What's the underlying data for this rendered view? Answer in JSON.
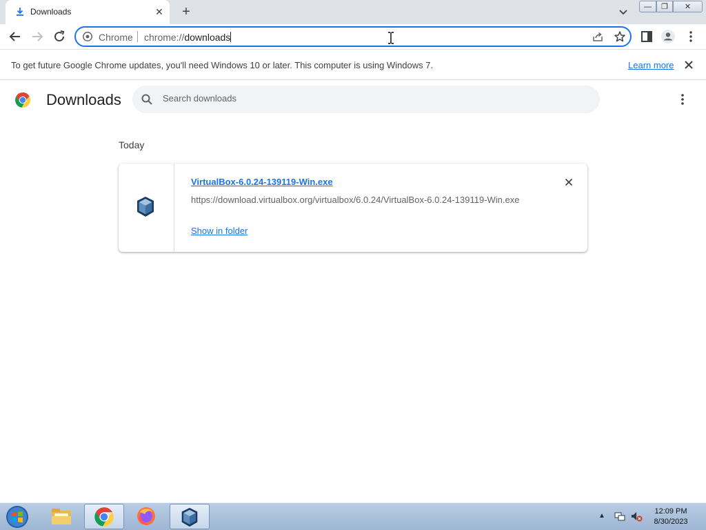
{
  "tab": {
    "title": "Downloads",
    "close_label": "✕",
    "new_tab_label": "+"
  },
  "window": {
    "minimize": "—",
    "maximize": "❐",
    "close": "✕"
  },
  "omnibox": {
    "chip": "Chrome",
    "url_scheme": "chrome://",
    "url_host": "downloads"
  },
  "infobar": {
    "message": "To get future Google Chrome updates, you'll need Windows 10 or later. This computer is using Windows 7.",
    "link": "Learn more"
  },
  "page": {
    "title": "Downloads",
    "search_placeholder": "Search downloads",
    "section": "Today"
  },
  "downloads": [
    {
      "file_name": "VirtualBox-6.0.24-139119-Win.exe",
      "url": "https://download.virtualbox.org/virtualbox/6.0.24/VirtualBox-6.0.24-139119-Win.exe",
      "action": "Show in folder"
    }
  ],
  "taskbar": {
    "apps": [
      "windows-explorer",
      "google-chrome",
      "firefox",
      "virtualbox"
    ],
    "clock_time": "12:09 PM",
    "clock_date": "8/30/2023"
  },
  "colors": {
    "accent": "#1a73e8",
    "tabstrip": "#dee1e6",
    "search_bg": "#f1f3f4"
  }
}
